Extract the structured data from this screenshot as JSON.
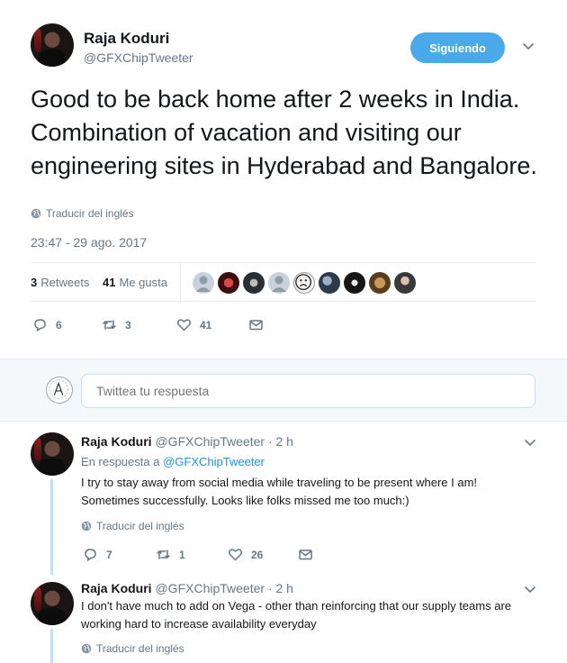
{
  "tweet": {
    "author_name": "Raja Koduri",
    "author_handle": "@GFXChipTweeter",
    "follow_label": "Siguiendo",
    "text": "Good to be back home after 2 weeks in India. Combination of vacation and visiting our engineering sites in Hyderabad and Bangalore.",
    "translate_label": "Traducir del inglés",
    "timestamp": "23:47 - 29 ago. 2017",
    "retweets_count": "3",
    "retweets_label": "Retweets",
    "likes_count": "41",
    "likes_label": "Me gusta",
    "actions": {
      "reply_count": "6",
      "retweet_count": "3",
      "like_count": "41"
    }
  },
  "reply_box": {
    "placeholder": "Twittea tu respuesta"
  },
  "replies": [
    {
      "author_name": "Raja Koduri",
      "meta": "@GFXChipTweeter · 2 h",
      "in_reply_prefix": "En respuesta a",
      "in_reply_handle": "@GFXChipTweeter",
      "text": "I try to stay away from social media while traveling to be present where I am! Sometimes successfully. Looks like folks missed me too much:)",
      "translate_label": "Traducir del inglés",
      "reply_count": "7",
      "retweet_count": "1",
      "like_count": "26"
    },
    {
      "author_name": "Raja Koduri",
      "meta": "@GFXChipTweeter · 2 h",
      "text": "I don't have much to add on Vega - other than reinforcing that our supply teams are working hard to increase availability everyday",
      "translate_label": "Traducir del inglés"
    }
  ],
  "colors": {
    "accent": "#1b95e0",
    "follow_button": "#4aa9e9",
    "muted": "#657786",
    "thread_line": "#c4dff3"
  }
}
